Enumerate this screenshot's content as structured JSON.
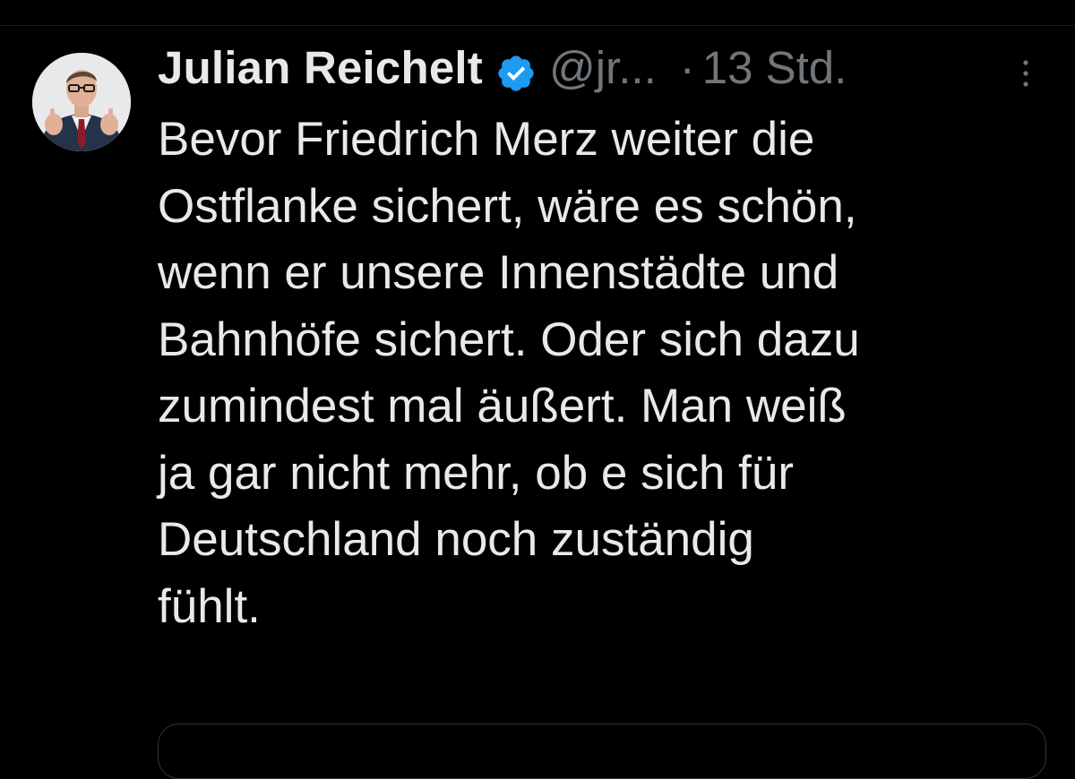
{
  "tweet": {
    "author": {
      "display_name": "Julian Reichelt",
      "handle": "@jr...",
      "verified_icon": "verified-badge-icon",
      "verified_color": "#1d9bf0",
      "avatar_icon": "profile-photo"
    },
    "separator": "·",
    "time_ago": "13 Std.",
    "more_icon": "more-vertical-icon",
    "text": "Bevor Friedrich Merz weiter die\nOstflanke sichert, wäre es schön,\nwenn er unsere Innenstädte und\nBahnhöfe sichert. Oder sich dazu\nzumindest mal äußert. Man weiß\nja gar nicht mehr, ob e sich für\nDeutschland noch zuständig\nfühlt."
  },
  "colors": {
    "background": "#000000",
    "text_primary": "#e7e9ea",
    "text_secondary": "#71767b",
    "accent": "#1d9bf0",
    "border": "#2f3336"
  }
}
